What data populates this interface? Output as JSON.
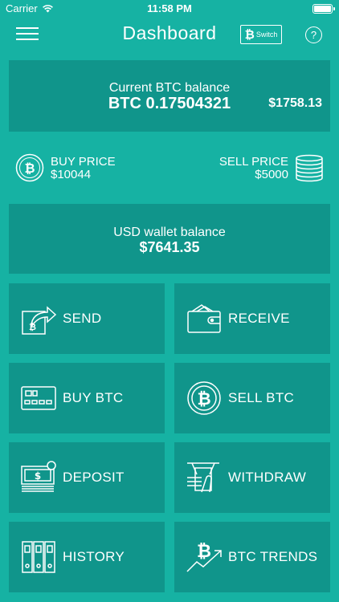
{
  "status_bar": {
    "carrier": "Carrier",
    "time": "11:58 PM"
  },
  "nav": {
    "title": "Dashboard",
    "switch_label": "Switch",
    "help_symbol": "?"
  },
  "balance": {
    "label": "Current BTC balance",
    "btc": "BTC 0.17504321",
    "usd": "$1758.13"
  },
  "prices": {
    "buy_label": "BUY PRICE",
    "buy_value": "$10044",
    "sell_label": "SELL PRICE",
    "sell_value": "$5000"
  },
  "wallet": {
    "label": "USD wallet balance",
    "value": "$7641.35"
  },
  "tiles": [
    {
      "label": "SEND",
      "icon": "send-icon"
    },
    {
      "label": "RECEIVE",
      "icon": "wallet-icon"
    },
    {
      "label": "BUY BTC",
      "icon": "credit-card-icon"
    },
    {
      "label": "SELL BTC",
      "icon": "bitcoin-coin-icon"
    },
    {
      "label": "DEPOSIT",
      "icon": "cash-deposit-icon"
    },
    {
      "label": "WITHDRAW",
      "icon": "atm-withdraw-icon"
    },
    {
      "label": "HISTORY",
      "icon": "binders-history-icon"
    },
    {
      "label": "BTC TRENDS",
      "icon": "bitcoin-trend-icon"
    }
  ],
  "colors": {
    "background": "#16B2A3",
    "card": "#10958B",
    "text": "#FFFFFF"
  }
}
